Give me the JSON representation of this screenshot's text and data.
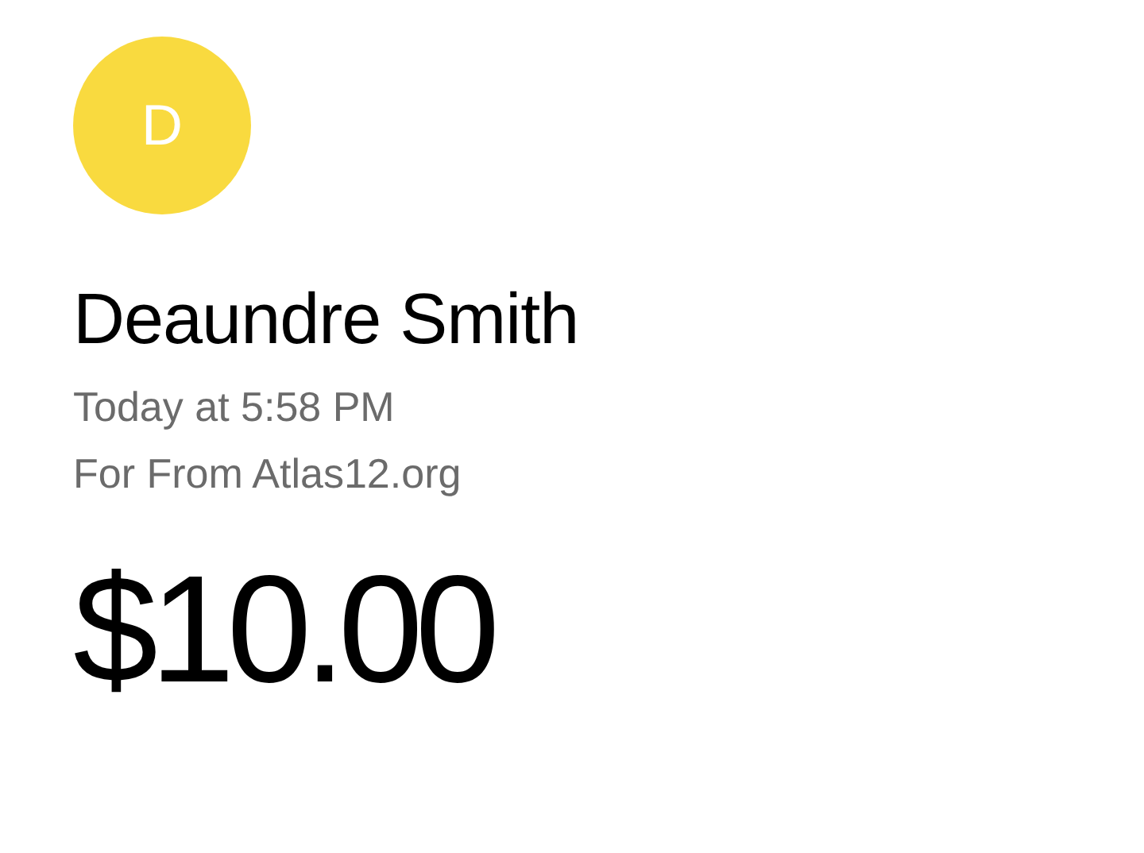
{
  "avatar": {
    "initial": "D",
    "color": "#f9da3f"
  },
  "name": "Deaundre Smith",
  "time": "Today at 5:58 PM",
  "note": "For From Atlas12.org",
  "amount": "$10.00"
}
